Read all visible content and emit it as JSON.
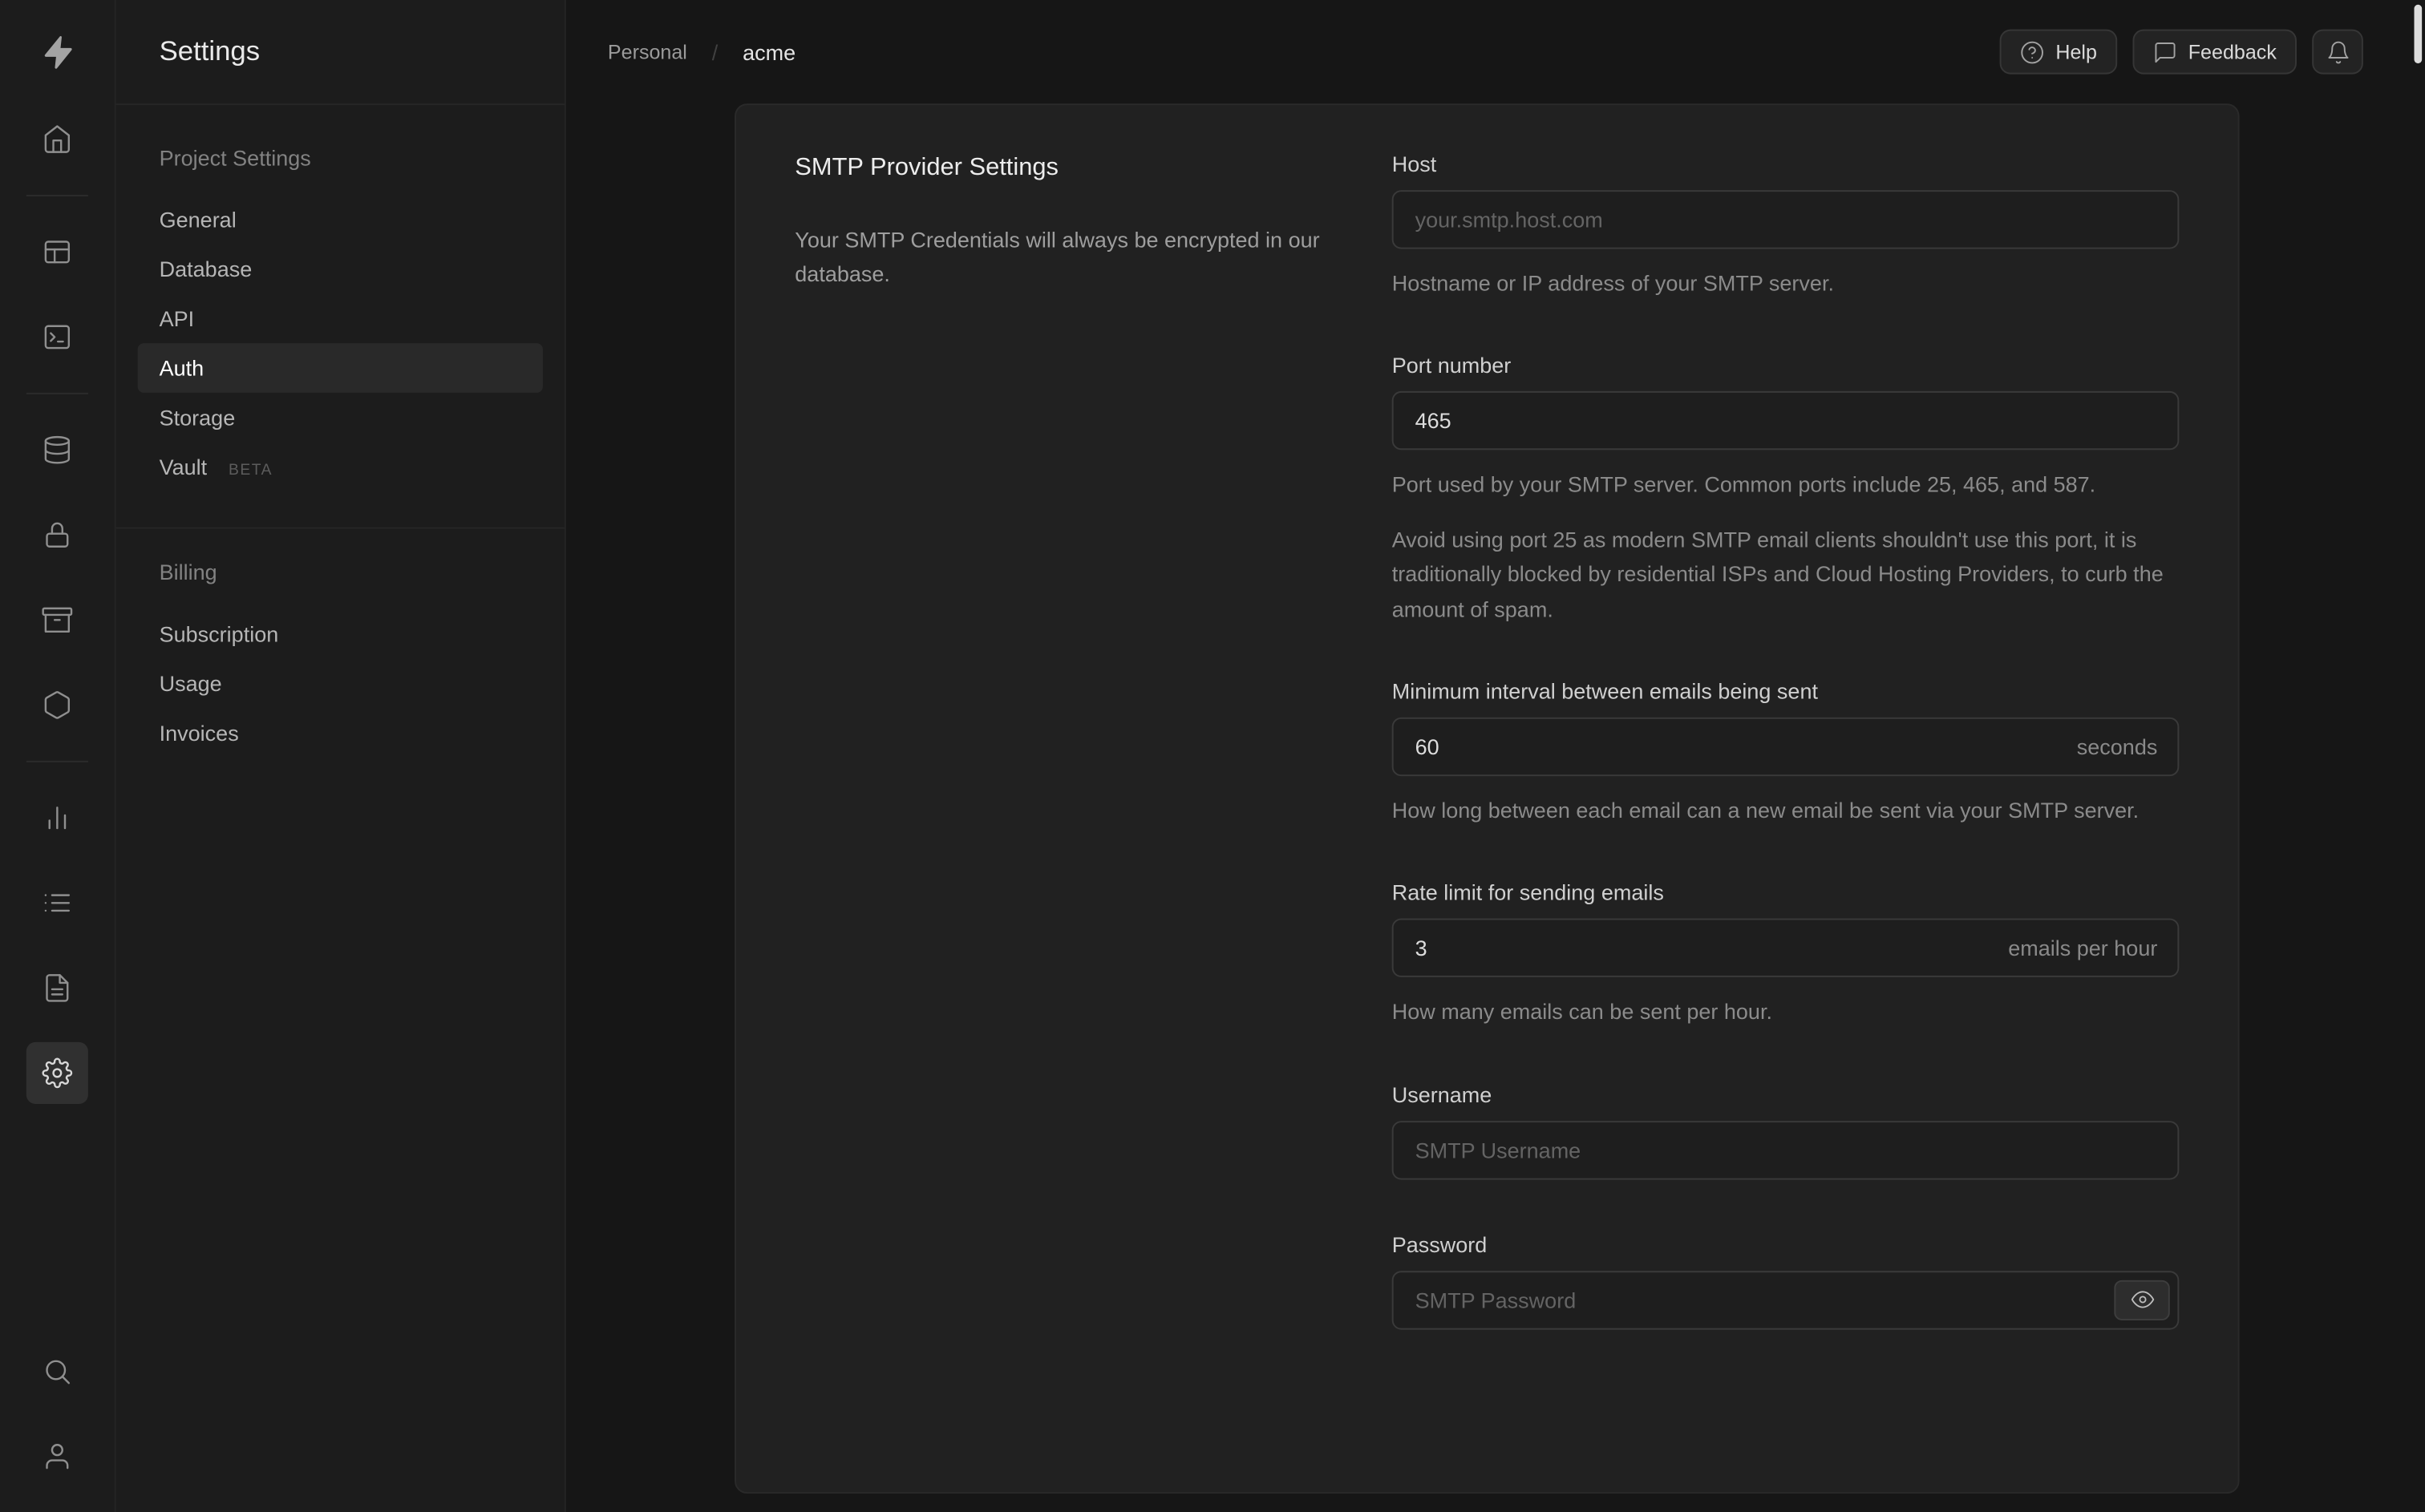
{
  "colors": {
    "page_background": "#161616",
    "sidebar_background": "#1c1c1c",
    "panel_background": "#212121",
    "input_background": "#1e1e1e",
    "border": "#363636",
    "text_primary": "#ededed",
    "text_muted": "#8b8b8b"
  },
  "icon_rail": {
    "logo": "supabase-logo",
    "items": [
      "home",
      "table-editor",
      "sql-editor",
      "database",
      "auth",
      "storage",
      "edge-functions",
      "reports",
      "logs",
      "docs",
      "settings"
    ],
    "active_item": "settings",
    "footer_items": [
      "search",
      "user"
    ]
  },
  "sidebar": {
    "title": "Settings",
    "sections": [
      {
        "heading": "Project Settings",
        "items": [
          {
            "label": "General"
          },
          {
            "label": "Database"
          },
          {
            "label": "API"
          },
          {
            "label": "Auth",
            "active": true
          },
          {
            "label": "Storage"
          },
          {
            "label": "Vault",
            "badge": "BETA"
          }
        ]
      },
      {
        "heading": "Billing",
        "items": [
          {
            "label": "Subscription"
          },
          {
            "label": "Usage"
          },
          {
            "label": "Invoices"
          }
        ]
      }
    ]
  },
  "header": {
    "breadcrumb": {
      "org": "Personal",
      "separator": "/",
      "project": "acme"
    },
    "help_label": "Help",
    "feedback_label": "Feedback",
    "icons": [
      "help-circle",
      "message-bubble",
      "bell"
    ]
  },
  "content": {
    "section_title": "SMTP Provider Settings",
    "section_description": "Your SMTP Credentials will always be encrypted in our database.",
    "fields": {
      "host": {
        "label": "Host",
        "placeholder": "your.smtp.host.com",
        "helper": "Hostname or IP address of your SMTP server."
      },
      "port": {
        "label": "Port number",
        "value": "465",
        "helper1": "Port used by your SMTP server. Common ports include 25, 465, and 587.",
        "helper2": "Avoid using port 25 as modern SMTP email clients shouldn't use this port, it is traditionally blocked by residential ISPs and Cloud Hosting Providers, to curb the amount of spam."
      },
      "interval": {
        "label": "Minimum interval between emails being sent",
        "value": "60",
        "suffix": "seconds",
        "helper": "How long between each email can a new email be sent via your SMTP server."
      },
      "rate": {
        "label": "Rate limit for sending emails",
        "value": "3",
        "suffix": "emails per hour",
        "helper": "How many emails can be sent per hour."
      },
      "username": {
        "label": "Username",
        "placeholder": "SMTP Username"
      },
      "password": {
        "label": "Password",
        "placeholder": "SMTP Password"
      }
    }
  }
}
